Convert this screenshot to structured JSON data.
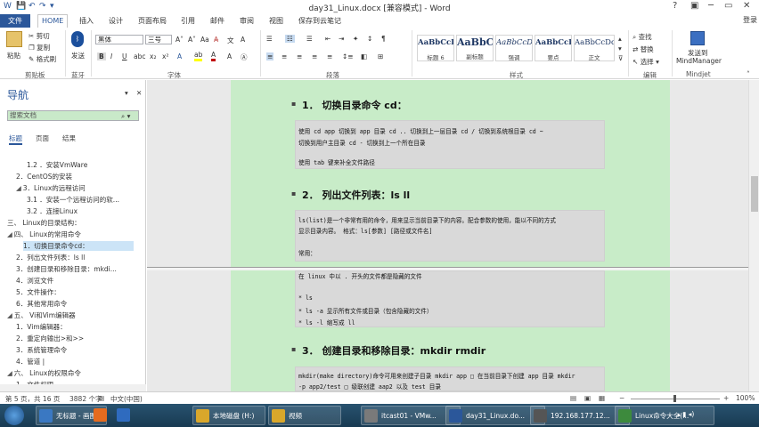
{
  "titlebar": {
    "title": "day31_Linux.docx [兼容模式] - Word",
    "help": "?",
    "min": "─",
    "max": "▭",
    "close": "✕",
    "login": "登录"
  },
  "tabs": [
    "文件",
    "HOME",
    "插入",
    "设计",
    "页面布局",
    "引用",
    "邮件",
    "审阅",
    "视图",
    "保存到云笔记"
  ],
  "ribbon": {
    "clipboard": {
      "paste": "粘贴",
      "cut": "剪切",
      "copy": "复制",
      "format_painter": "格式刷",
      "label": "剪贴板"
    },
    "bluetooth": {
      "send": "发送",
      "label": "蓝牙"
    },
    "font": {
      "name": "黑体",
      "size": "三号",
      "label": "字体"
    },
    "paragraph": {
      "label": "段落"
    },
    "styles": {
      "label": "样式",
      "cards": [
        {
          "sample": "AaBbCcI",
          "name": "标题 6"
        },
        {
          "sample": "AaBbC",
          "name": "副标题"
        },
        {
          "sample": "AaBbCcDt",
          "name": "强调"
        },
        {
          "sample": "AaBbCcD",
          "name": "要点"
        },
        {
          "sample": "AaBbCcDd",
          "name": "正文"
        }
      ]
    },
    "editing": {
      "find": "查找",
      "replace": "替换",
      "select": "选择",
      "label": "编辑"
    },
    "mindjet": {
      "send": "发送到",
      "app": "MindManager",
      "label": "Mindjet"
    }
  },
  "nav": {
    "title": "导航",
    "search_placeholder": "搜索文档",
    "tabs": [
      "标题",
      "页面",
      "结果"
    ],
    "items": [
      {
        "text": "1.2 ．安装VmWare",
        "level": 2,
        "tri": ""
      },
      {
        "text": "2．CentOS的安装",
        "level": 1,
        "tri": ""
      },
      {
        "text": "3．Linux的远程访问",
        "level": 1,
        "tri": "◢"
      },
      {
        "text": "3.1 ．安装一个远程访问的软...",
        "level": 2,
        "tri": ""
      },
      {
        "text": "3.2 ．连接Linux",
        "level": 2,
        "tri": ""
      },
      {
        "text": "三、 Linux的目录结构：",
        "level": 0,
        "tri": ""
      },
      {
        "text": "四、 Linux的常用命令",
        "level": 0,
        "tri": "◢"
      },
      {
        "text": "1．切换目录命令cd：",
        "level": 1,
        "tri": "",
        "selected": true
      },
      {
        "text": "2．列出文件列表：ls ll",
        "level": 1,
        "tri": ""
      },
      {
        "text": "3．创建目录和移除目录：mkdi...",
        "level": 1,
        "tri": ""
      },
      {
        "text": "4．浏览文件",
        "level": 1,
        "tri": ""
      },
      {
        "text": "5．文件操作：",
        "level": 1,
        "tri": ""
      },
      {
        "text": "6．其他常用命令",
        "level": 1,
        "tri": ""
      },
      {
        "text": "五、 Vi和Vim编辑器",
        "level": 0,
        "tri": "◢"
      },
      {
        "text": "1．Vim编辑器：",
        "level": 1,
        "tri": ""
      },
      {
        "text": "2．重定向输出>和>>",
        "level": 1,
        "tri": ""
      },
      {
        "text": "3．系统管理命令",
        "level": 1,
        "tri": ""
      },
      {
        "text": "4．管道 |",
        "level": 1,
        "tri": ""
      },
      {
        "text": "六、 Linux的权限命令",
        "level": 0,
        "tri": "◢"
      },
      {
        "text": "1．文件权限",
        "level": 1,
        "tri": ""
      }
    ]
  },
  "document": {
    "h1": "1． 切换目录命令 cd：",
    "code1": [
      "使用 cd app  切换到 app 目录 cd ..  切换到上一层目录 cd /     切换到系统根目录 cd ~",
      "    切换到用户主目录 cd -     切换到上一个所在目录",
      "使用 tab 键来补全文件路径"
    ],
    "h2": "2． 列出文件列表：ls ll",
    "code2": [
      "    ls(list)是一个非常有用的命令，用来显示当前目录下的内容。配合参数的使用，能以不同的方式",
      "显示目录内容。    格式：ls[参数] [路径或文件名]",
      "",
      "    常用：",
      "    在 linux 中以 . 开头的文件都是隐藏的文件",
      "",
      "    * ls",
      "    * ls -a  显示所有文件或目录（包含隐藏的文件）",
      "    * ls -l  缩写成 ll"
    ],
    "h3": "3． 创建目录和移除目录：mkdir rmdir",
    "code3": [
      "mkdir(make directory)命令可用来创建子目录 mkdir app  □  在当前目录下创建 app 目录 mkdir",
      "   -p app2/test  □ 级联创建 aap2 以及 test 目录"
    ]
  },
  "status": {
    "page": "第 5 页，共 16 页",
    "words": "3882 个字",
    "lang": "中文(中国)",
    "zoom": "100%"
  },
  "taskbar": {
    "items": [
      {
        "label": "无标题 - 画图",
        "color": "#3a78c2"
      },
      {
        "label": "",
        "color": "#e56b1f"
      },
      {
        "label": "",
        "color": "#2f6bbf"
      },
      {
        "label": "本地磁盘 (H:)",
        "color": "#d9a72b"
      },
      {
        "label": "视频",
        "color": "#d9a72b"
      },
      {
        "label": "itcast01 - VMw...",
        "color": "#7a7a7a"
      },
      {
        "label": "day31_Linux.do...",
        "color": "#2b579a"
      },
      {
        "label": "192.168.177.12...",
        "color": "#555"
      },
      {
        "label": "Linux命令大全(...",
        "color": "#3d8a3d"
      }
    ],
    "time": ""
  },
  "colors": {
    "accent": "#2b579a",
    "page_bg": "#c8ecc8",
    "code_bg": "#d9d9d9"
  }
}
